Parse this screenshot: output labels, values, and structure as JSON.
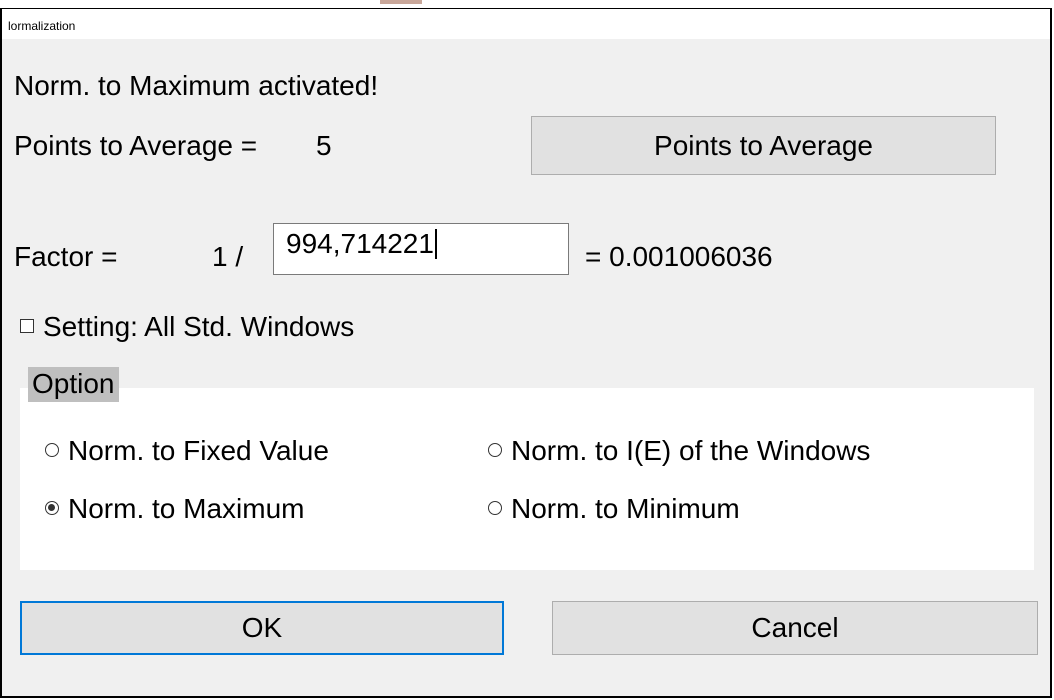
{
  "window": {
    "title": "lormalization"
  },
  "status": {
    "message": "Norm. to Maximum activated!"
  },
  "points": {
    "label": "Points to Average =",
    "value": "5",
    "button_label": "Points to Average"
  },
  "factor": {
    "label": "Factor =",
    "prefix": "1 /",
    "input_value": "994,714221",
    "result": "= 0.001006036"
  },
  "setting": {
    "checkbox_label": "Setting: All Std. Windows",
    "checked": false
  },
  "option_group": {
    "label": "Option",
    "options": [
      {
        "label": "Norm. to Fixed Value",
        "selected": false
      },
      {
        "label": "Norm. to I(E) of the Windows",
        "selected": false
      },
      {
        "label": "Norm. to Maximum",
        "selected": true
      },
      {
        "label": "Norm. to Minimum",
        "selected": false
      }
    ]
  },
  "buttons": {
    "ok_label": "OK",
    "cancel_label": "Cancel"
  },
  "colors": {
    "window_background": "#f0f0f0",
    "button_face": "#e1e1e1",
    "default_button_border": "#0078d7",
    "group_label_background": "#bfbfbf"
  }
}
